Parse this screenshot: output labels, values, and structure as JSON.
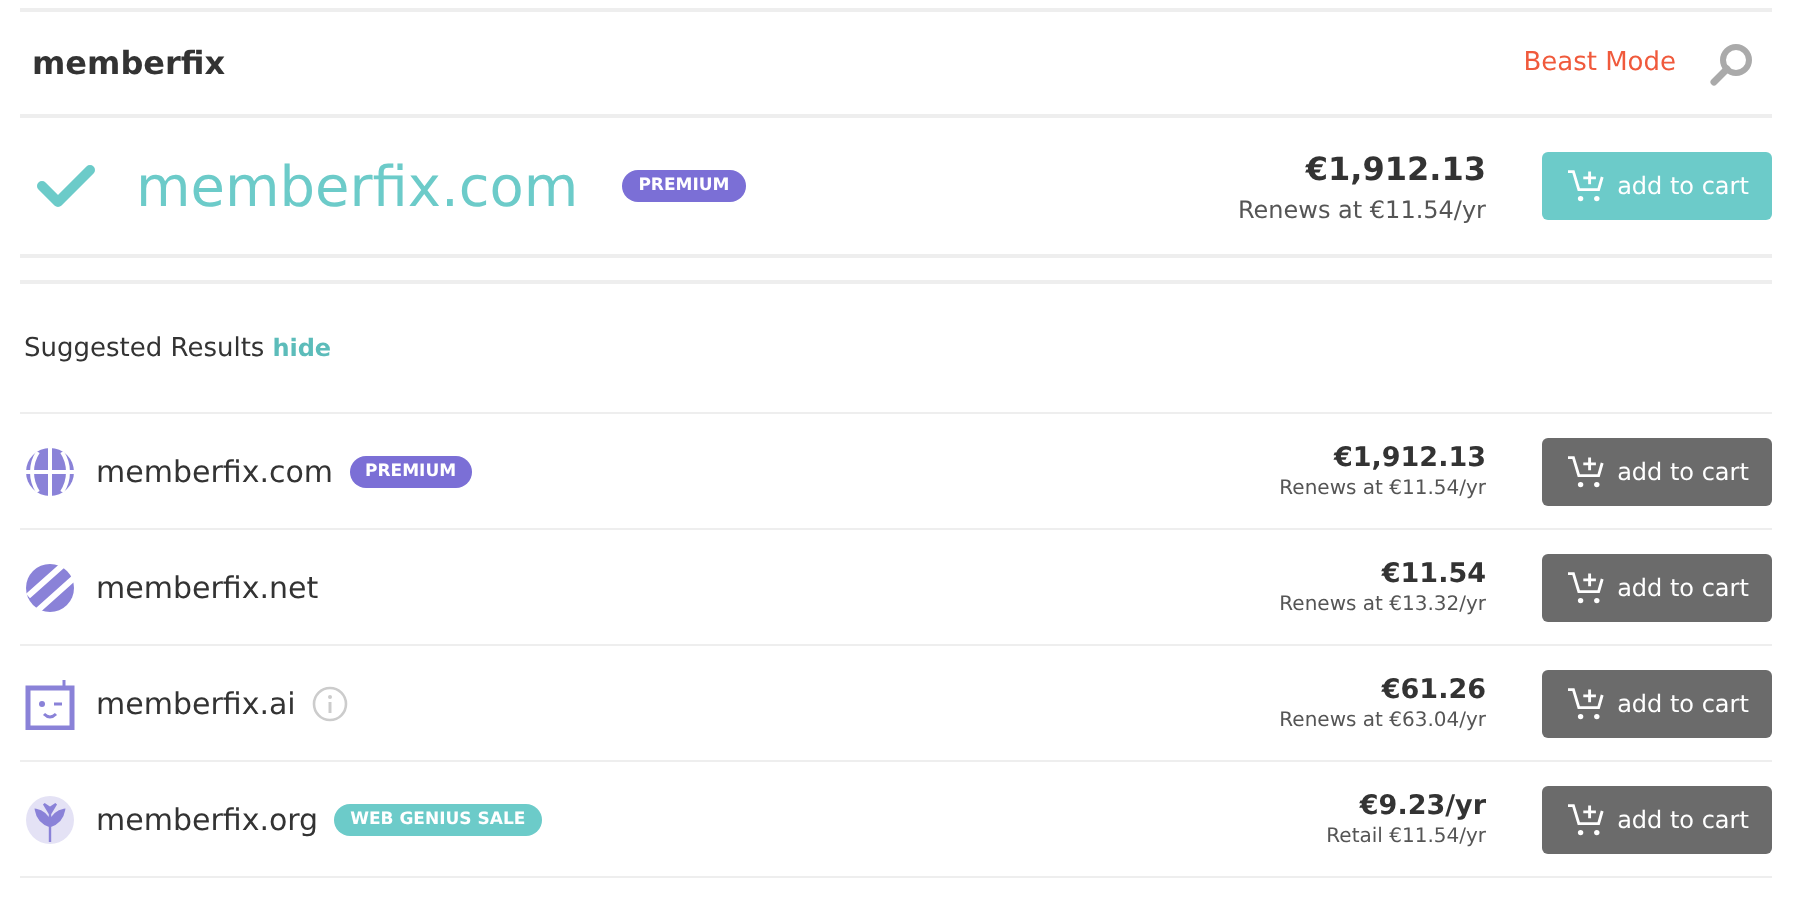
{
  "search": {
    "query": "memberfix",
    "mode_link": "Beast Mode"
  },
  "featured": {
    "domain": "memberfix.com",
    "available": true,
    "badge": {
      "kind": "premium",
      "label": "PREMIUM"
    },
    "price": "€1,912.13",
    "renewal": "Renews at €11.54/yr",
    "button": "add to cart"
  },
  "suggested": {
    "title": "Suggested Results",
    "toggle": "hide",
    "rows": [
      {
        "kind": "globe",
        "domain": "memberfix.com",
        "info": false,
        "badge": {
          "kind": "premium",
          "label": "PREMIUM"
        },
        "price": "€1,912.13",
        "note": "Renews at €11.54/yr",
        "button": "add to cart"
      },
      {
        "kind": "stripes",
        "domain": "memberfix.net",
        "info": false,
        "price": "€11.54",
        "note": "Renews at €13.32/yr",
        "button": "add to cart"
      },
      {
        "kind": "robot",
        "domain": "memberfix.ai",
        "info": true,
        "price": "€61.26",
        "note": "Renews at €63.04/yr",
        "button": "add to cart"
      },
      {
        "kind": "plant",
        "domain": "memberfix.org",
        "info": false,
        "badge": {
          "kind": "sale",
          "label": "WEB GENIUS SALE"
        },
        "price": "€9.23/yr",
        "note": "Retail €11.54/yr",
        "button": "add to cart"
      }
    ]
  }
}
